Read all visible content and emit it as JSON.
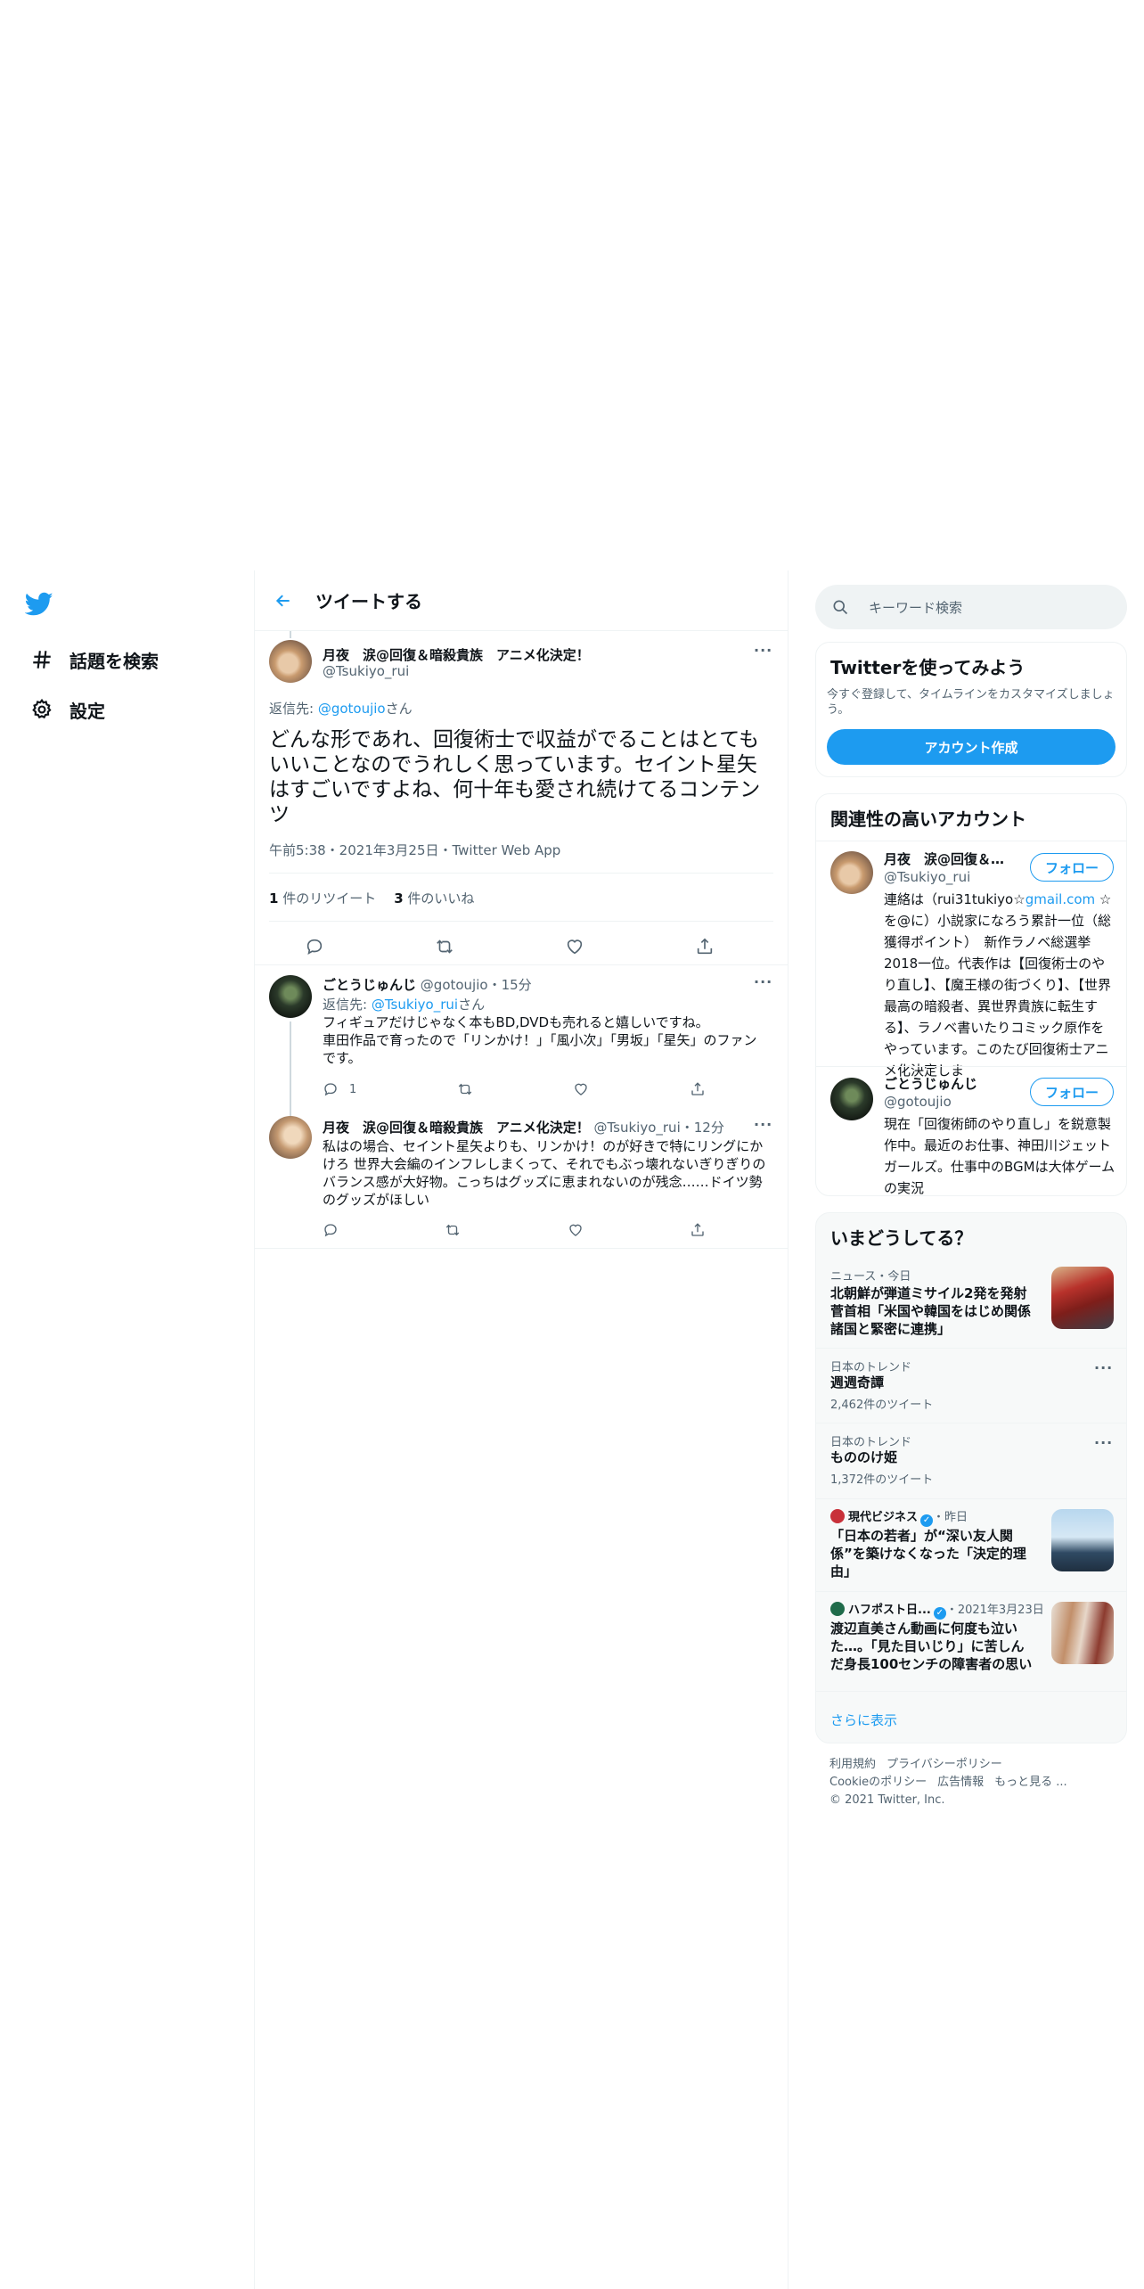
{
  "nav": {
    "items": [
      {
        "label": "話題を検索",
        "icon": "hash-icon"
      },
      {
        "label": "設定",
        "icon": "gear-icon"
      }
    ]
  },
  "center": {
    "title": "ツイートする",
    "main_tweet": {
      "name": "月夜　涙@回復＆暗殺貴族　アニメ化決定！",
      "handle": "@Tsukiyo_rui",
      "reply_prefix": "返信先: ",
      "reply_target": "@gotoujio",
      "reply_suffix": "さん",
      "text": "どんな形であれ、回復術士で収益がでることはとてもいいことなのでうれしく思っています。セイント星矢はすごいですよね、何十年も愛され続けてるコンテンツ",
      "meta": "午前5:38・2021年3月25日・Twitter Web App",
      "retweets_count": "1",
      "retweets_label": " 件のリツイート",
      "likes_count": "3",
      "likes_label": " 件のいいね"
    },
    "replies": [
      {
        "name": "ごとうじゅんじ",
        "handle": "@gotoujio",
        "time": "・15分",
        "reply_prefix": "返信先: ",
        "reply_target": "@Tsukiyo_rui",
        "reply_suffix": "さん",
        "text": "フィギュアだけじゃなく本もBD,DVDも売れると嬉しいですね。\n車田作品で育ったので「リンかけ！」「風小次」「男坂」「星矢」のファンです。",
        "reply_count": "1"
      },
      {
        "name": "月夜　涙@回復＆暗殺貴族　アニメ化決定！",
        "handle": "@Tsukiyo_rui",
        "time": "・12分",
        "text": "私はの場合、セイント星矢よりも、リンかけ！のが好きで特にリングにかけろ 世界大会編のインフレしまくって、それでもぶっ壊れないぎりぎりのバランス感が大好物。こっちはグッズに恵まれないのが残念……ドイツ勢のグッズがほしい",
        "reply_count": ""
      }
    ]
  },
  "right": {
    "search_placeholder": "キーワード検索",
    "signup": {
      "title": "Twitterを使ってみよう",
      "desc": "今すぐ登録して、タイムラインをカスタマイズしましょう。",
      "button": "アカウント作成"
    },
    "related": {
      "title": "関連性の高いアカウント",
      "follow_label": "フォロー",
      "accounts": [
        {
          "name": "月夜　涙@回復＆暗...",
          "handle": "@Tsukiyo_rui",
          "bio_pre": "連絡は（rui31tukiyo☆",
          "bio_link": "gmail.com",
          "bio_post": " ☆を@に）小説家になろう累計一位（総獲得ポイント）　新作ラノベ総選挙2018一位。代表作は【回復術士のやり直し】、【魔王様の街づくり】、【世界最高の暗殺者、異世界貴族に転生する】、ラノベ書いたりコミック原作をやっています。このたび回復術士アニメ化決定しま"
        },
        {
          "name": "ごとうじゅんじ",
          "handle": "@gotoujio",
          "bio_pre": "現在「回復術師のやり直し」を鋭意製作中。最近のお仕事、神田川ジェットガールズ。仕事中のBGMは大体ゲームの実況",
          "bio_link": "",
          "bio_post": ""
        }
      ]
    },
    "trends": {
      "title": "いまどうしてる？",
      "items": [
        {
          "meta": "ニュース・今日",
          "title": "北朝鮮が弾道ミサイル2発を発射 菅首相「米国や韓国をはじめ関係諸国と緊密に連携」"
        },
        {
          "meta": "日本のトレンド",
          "title": "週週奇譚",
          "count": "2,462件のツイート"
        },
        {
          "meta": "日本のトレンド",
          "title": "もののけ姫",
          "count": "1,372件のツイート"
        },
        {
          "source": "現代ビジネス",
          "meta": "・昨日",
          "title": "「日本の若者」が“深い友人関係”を築けなくなった「決定的理由」"
        },
        {
          "source": "ハフポスト日...",
          "meta": "・2021年3月23日",
          "title": "渡辺直美さん動画に何度も泣いた…。「見た目いじり」に苦しんだ身長100センチの障害者の思い"
        }
      ],
      "show_more": "さらに表示"
    },
    "footer": {
      "links1": [
        "利用規約",
        "プライバシーポリシー"
      ],
      "links2": [
        "Cookieのポリシー",
        "広告情報",
        "もっと見る ..."
      ],
      "copyright": "© 2021 Twitter, Inc."
    }
  },
  "colors": {
    "accent": "#1d9bf0",
    "text": "#0f1419",
    "muted": "#536471",
    "border": "#eff3f4"
  }
}
